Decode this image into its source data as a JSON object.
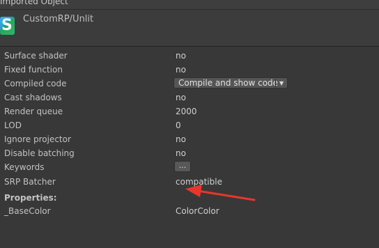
{
  "window": {
    "title": "Imported Object"
  },
  "asset": {
    "icon_letter": "S",
    "name": "CustomRP/Unlit"
  },
  "properties": [
    {
      "label": "Surface shader",
      "value": "no"
    },
    {
      "label": "Fixed function",
      "value": "no"
    },
    {
      "label": "Compiled code",
      "control": "dropdown",
      "value": "Compile and show code"
    },
    {
      "label": "Cast shadows",
      "value": "no"
    },
    {
      "label": "Render queue",
      "value": "2000"
    },
    {
      "label": "LOD",
      "value": "0"
    },
    {
      "label": "Ignore projector",
      "value": "no"
    },
    {
      "label": "Disable batching",
      "value": "no"
    },
    {
      "label": "Keywords",
      "control": "button",
      "value": "..."
    },
    {
      "label": "SRP Batcher",
      "value": "compatible"
    }
  ],
  "section": {
    "label": "Properties:"
  },
  "shader_properties": [
    {
      "label": "_BaseColor",
      "value": "ColorColor"
    }
  ],
  "colors": {
    "background": "#383838",
    "annotation_arrow": "#e8372a"
  }
}
